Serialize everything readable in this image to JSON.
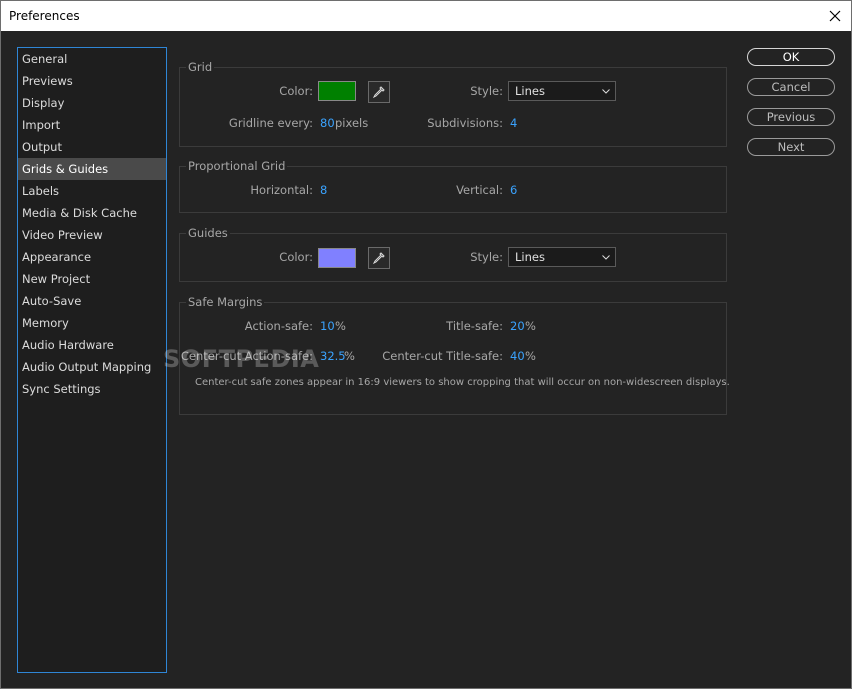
{
  "window": {
    "title": "Preferences"
  },
  "colors": {
    "grid_color": "#008000",
    "guides_color": "#8080ff",
    "accent": "#2f86d6",
    "value": "#3aa3ff"
  },
  "sidebar": {
    "items": [
      {
        "label": "General"
      },
      {
        "label": "Previews"
      },
      {
        "label": "Display"
      },
      {
        "label": "Import"
      },
      {
        "label": "Output"
      },
      {
        "label": "Grids & Guides",
        "selected": true
      },
      {
        "label": "Labels"
      },
      {
        "label": "Media & Disk Cache"
      },
      {
        "label": "Video Preview"
      },
      {
        "label": "Appearance"
      },
      {
        "label": "New Project"
      },
      {
        "label": "Auto-Save"
      },
      {
        "label": "Memory"
      },
      {
        "label": "Audio Hardware"
      },
      {
        "label": "Audio Output Mapping"
      },
      {
        "label": "Sync Settings"
      }
    ]
  },
  "grid": {
    "title": "Grid",
    "color_label": "Color:",
    "style_label": "Style:",
    "style_value": "Lines",
    "gridline_label": "Gridline every:",
    "gridline_value": "80",
    "gridline_unit": "pixels",
    "subdivisions_label": "Subdivisions:",
    "subdivisions_value": "4"
  },
  "proportional_grid": {
    "title": "Proportional Grid",
    "horizontal_label": "Horizontal:",
    "horizontal_value": "8",
    "vertical_label": "Vertical:",
    "vertical_value": "6"
  },
  "guides": {
    "title": "Guides",
    "color_label": "Color:",
    "style_label": "Style:",
    "style_value": "Lines"
  },
  "safe_margins": {
    "title": "Safe Margins",
    "action_safe_label": "Action-safe:",
    "action_safe_value": "10",
    "title_safe_label": "Title-safe:",
    "title_safe_value": "20",
    "cc_action_label": "Center-cut Action-safe:",
    "cc_action_value": "32.5",
    "cc_title_label": "Center-cut Title-safe:",
    "cc_title_value": "40",
    "percent": "%",
    "note": "Center-cut safe zones appear in 16:9 viewers to show cropping that will occur on non-widescreen displays."
  },
  "buttons": {
    "ok": "OK",
    "cancel": "Cancel",
    "previous": "Previous",
    "next": "Next"
  },
  "watermark": "SOFTPEDIA"
}
